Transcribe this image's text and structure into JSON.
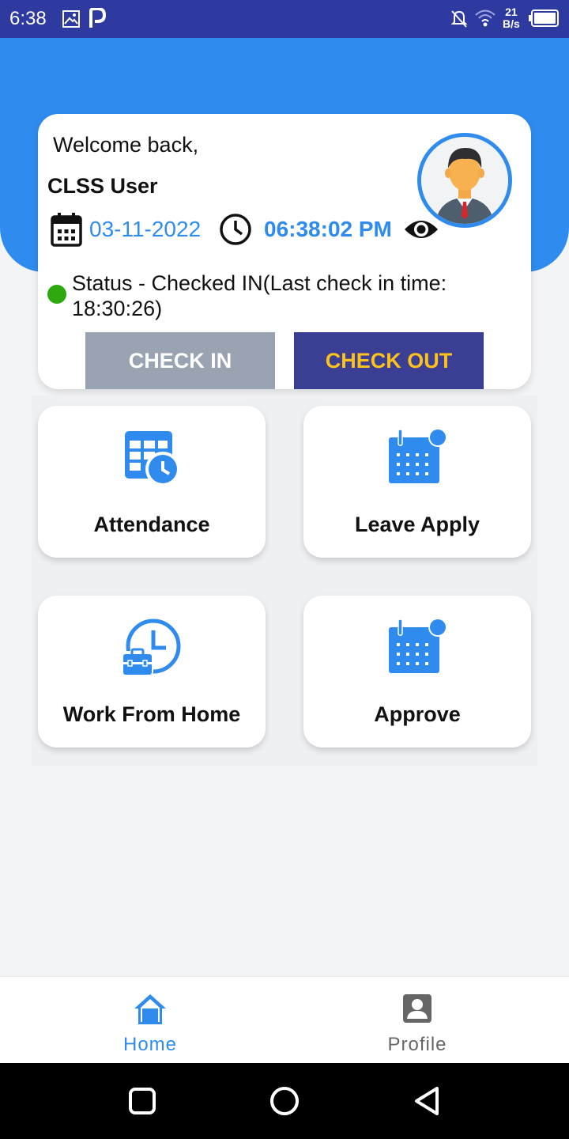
{
  "status_bar": {
    "time": "6:38",
    "rate_top": "21",
    "rate_bottom": "B/s",
    "icons": [
      "image-icon",
      "p-icon",
      "mute-icon",
      "wifi-icon",
      "battery-icon"
    ]
  },
  "card": {
    "welcome": "Welcome back,",
    "username": "CLSS User",
    "date": "03-11-2022",
    "time": "06:38:02 PM",
    "status": "Status - Checked IN(Last check in time: 18:30:26)",
    "check_in_label": "CHECK IN",
    "check_out_label": "CHECK OUT"
  },
  "tiles": [
    {
      "label": "Attendance",
      "icon": "attendance-icon"
    },
    {
      "label": "Leave Apply",
      "icon": "calendar-icon"
    },
    {
      "label": "Work From Home",
      "icon": "work-from-home-icon"
    },
    {
      "label": "Approve",
      "icon": "calendar-icon"
    }
  ],
  "bottom_nav": {
    "home": "Home",
    "profile": "Profile"
  },
  "colors": {
    "primary": "#2f8cee",
    "status_bar": "#2f3aa0",
    "check_out_bg": "#3a3f94",
    "check_out_text": "#ffc21a",
    "check_in_bg": "#9aa3b1",
    "status_dot": "#2fa80e"
  }
}
